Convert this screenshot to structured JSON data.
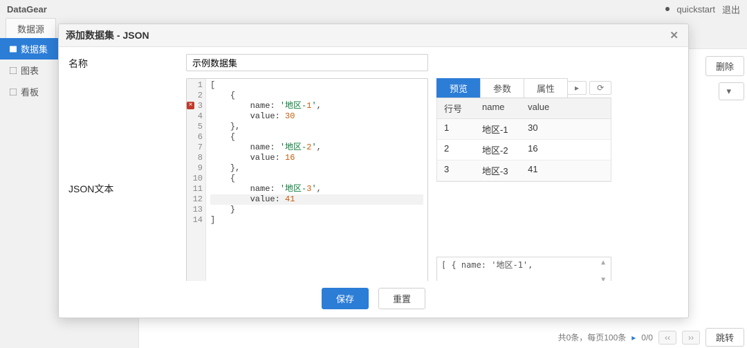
{
  "brand": "DataGear",
  "header": {
    "user": "quickstart",
    "logout": "退出"
  },
  "topTab": "数据源",
  "sidebar": {
    "items": [
      {
        "id": "dataset",
        "label": "数据集",
        "active": true
      },
      {
        "id": "chart",
        "label": "图表",
        "active": false
      },
      {
        "id": "board",
        "label": "看板",
        "active": false
      }
    ]
  },
  "bgToolbar": {
    "delete": "删除"
  },
  "bgFooter": {
    "summary": "共0条，每页100条",
    "page": "0/0",
    "jump": "跳转"
  },
  "dialog": {
    "title": "添加数据集 - JSON",
    "nameLabel": "名称",
    "nameValue": "示例数据集",
    "jsonLabel": "JSON文本",
    "code": {
      "lines": [
        {
          "n": 1,
          "text": "["
        },
        {
          "n": 2,
          "text": "    {"
        },
        {
          "n": 3,
          "text": "        name: '地区-1',",
          "error": true
        },
        {
          "n": 4,
          "text": "        value: 30"
        },
        {
          "n": 5,
          "text": "    },"
        },
        {
          "n": 6,
          "text": "    {"
        },
        {
          "n": 7,
          "text": "        name: '地区-2',"
        },
        {
          "n": 8,
          "text": "        value: 16"
        },
        {
          "n": 9,
          "text": "    },"
        },
        {
          "n": 10,
          "text": "    {"
        },
        {
          "n": 11,
          "text": "        name: '地区-3',"
        },
        {
          "n": 12,
          "text": "        value: 41",
          "caret": true
        },
        {
          "n": 13,
          "text": "    }"
        },
        {
          "n": 14,
          "text": "]"
        }
      ]
    },
    "preview": {
      "tabs": {
        "preview": "预览",
        "params": "参数",
        "attrs": "属性"
      },
      "actions": {
        "run": "▸",
        "refresh": "⟳"
      },
      "cols": {
        "idx": "行号",
        "name": "name",
        "value": "value"
      },
      "rows": [
        {
          "i": "1",
          "name": "地区-1",
          "value": "30"
        },
        {
          "i": "2",
          "name": "地区-2",
          "value": "16"
        },
        {
          "i": "3",
          "name": "地区-3",
          "value": "41"
        }
      ],
      "raw": "[\n    {\n        name: '地区-1',"
    },
    "footer": {
      "save": "保存",
      "reset": "重置"
    }
  }
}
